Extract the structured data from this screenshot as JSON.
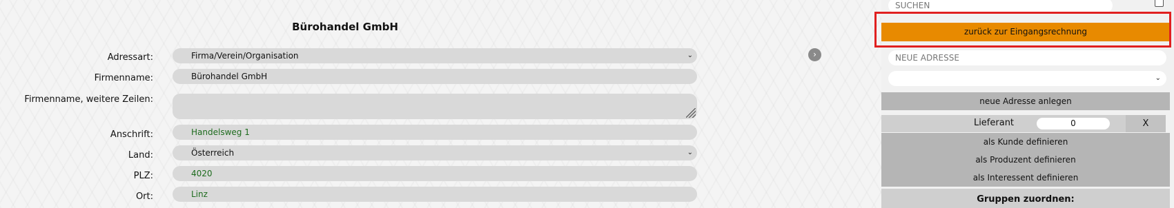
{
  "form": {
    "title": "Bürohandel GmbH",
    "fields": {
      "adressart": {
        "label": "Adressart:",
        "value": "Firma/Verein/Organisation"
      },
      "firmenname": {
        "label": "Firmenname:",
        "value": "Bürohandel GmbH"
      },
      "firmenname_weitere": {
        "label": "Firmenname, weitere Zeilen:",
        "value": ""
      },
      "anschrift": {
        "label": "Anschrift:",
        "value": "Handelsweg 1"
      },
      "land": {
        "label": "Land:",
        "value": "Österreich"
      },
      "plz": {
        "label": "PLZ:",
        "value": "4020"
      },
      "ort": {
        "label": "Ort:",
        "value": "Linz"
      }
    }
  },
  "sidebar": {
    "search_placeholder": "SUCHEN",
    "back_button": "zurück zur Eingangsrechnung",
    "new_address_placeholder": "NEUE ADRESSE",
    "new_address_select": "",
    "create_button": "neue Adresse anlegen",
    "lieferant_label": "Lieferant",
    "lieferant_value": "0",
    "remove_button": "X",
    "as_customer": "als Kunde definieren",
    "as_producer": "als Produzent definieren",
    "as_interested": "als Interessent definieren",
    "groups_heading": "Gruppen zuordnen:"
  },
  "colors": {
    "accent_orange": "#e88a00",
    "highlight_red": "#e02020"
  }
}
